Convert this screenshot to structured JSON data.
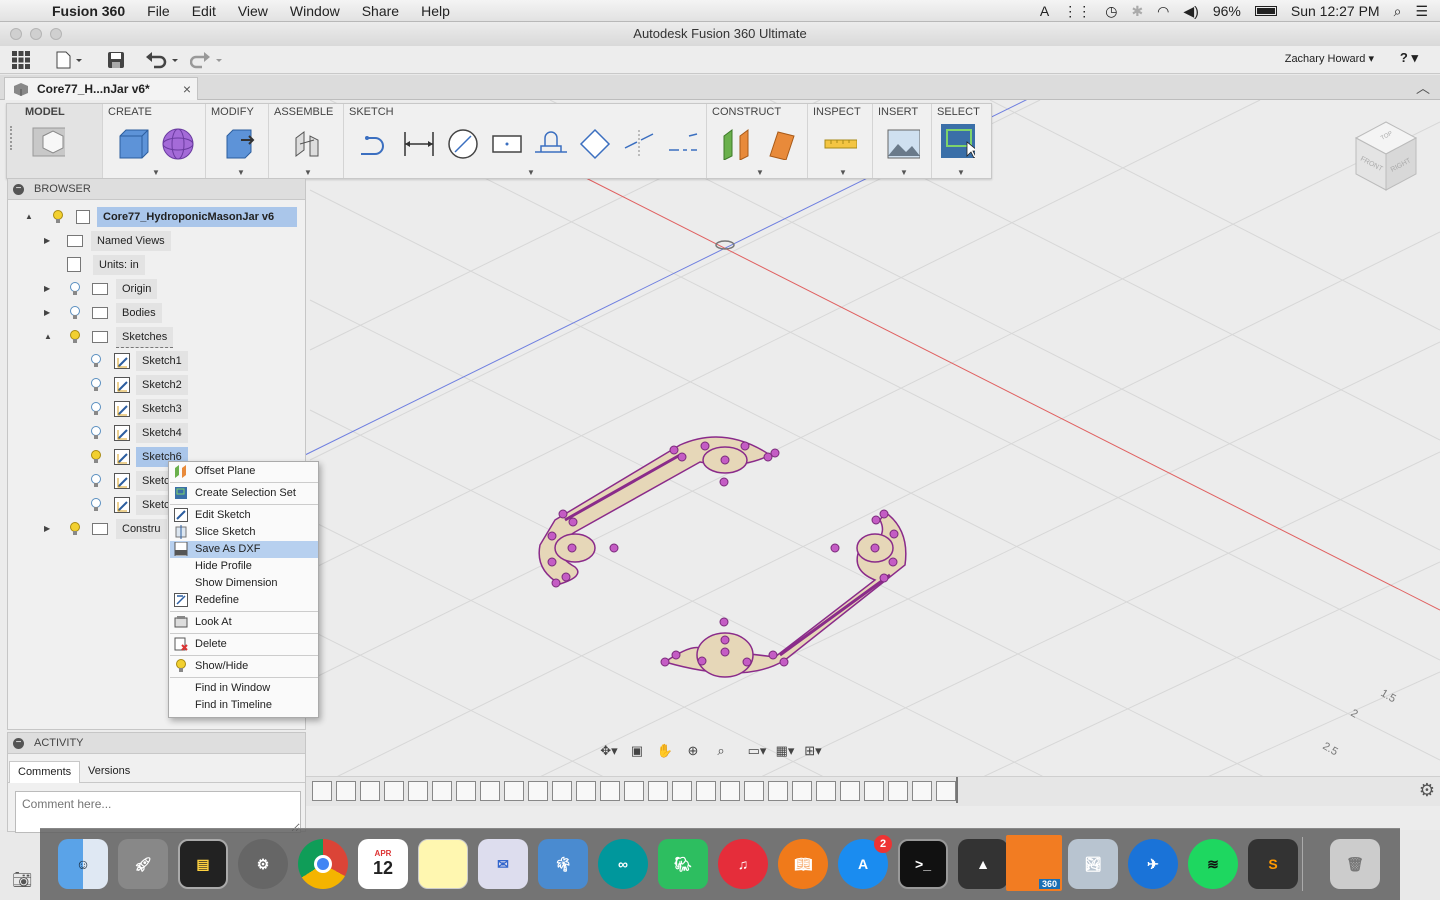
{
  "menubar": {
    "app_name": "Fusion 360",
    "items": [
      "File",
      "Edit",
      "View",
      "Window",
      "Share",
      "Help"
    ],
    "battery": "96%",
    "clock": "Sun 12:27 PM"
  },
  "window": {
    "title": "Autodesk Fusion 360 Ultimate"
  },
  "toolbar": {
    "user": "Zachary Howard ▾",
    "help": "? ▾"
  },
  "document_tab": {
    "title": "Core77_H...nJar v6*",
    "close": "×"
  },
  "ribbon": {
    "groups": [
      {
        "label": "MODEL"
      },
      {
        "label": "CREATE"
      },
      {
        "label": "MODIFY"
      },
      {
        "label": "ASSEMBLE"
      },
      {
        "label": "SKETCH"
      },
      {
        "label": "CONSTRUCT"
      },
      {
        "label": "INSPECT"
      },
      {
        "label": "INSERT"
      },
      {
        "label": "SELECT"
      }
    ]
  },
  "viewcube": {
    "top": "TOP",
    "front": "FRONT",
    "right": "RIGHT"
  },
  "browser": {
    "title": "BROWSER",
    "root": "Core77_HydroponicMasonJar v6",
    "nodes": {
      "named_views": "Named Views",
      "units": "Units: in",
      "origin": "Origin",
      "bodies": "Bodies",
      "sketches": "Sketches",
      "sketch1": "Sketch1",
      "sketch2": "Sketch2",
      "sketch3": "Sketch3",
      "sketch4": "Sketch4",
      "sketch6": "Sketch6",
      "sketch7": "Sketc",
      "sketch8": "Sketc",
      "construction": "Constru"
    }
  },
  "context_menu": {
    "items": [
      "Offset Plane",
      "Create Selection Set",
      "Edit Sketch",
      "Slice Sketch",
      "Save As DXF",
      "Hide Profile",
      "Show Dimension",
      "Redefine",
      "Look At",
      "Delete",
      "Show/Hide",
      "Find in Window",
      "Find in Timeline"
    ],
    "highlighted": "Save As DXF"
  },
  "activity": {
    "title": "ACTIVITY",
    "tabs": [
      "Comments",
      "Versions"
    ],
    "comment_placeholder": "Comment here..."
  },
  "grid_labels": [
    "1.5",
    "2",
    "2.5"
  ],
  "dock": {
    "calendar_month": "APR",
    "calendar_day": "12",
    "appstore_badge": "2",
    "fusion_label": "360"
  },
  "colors": {
    "sketch_fill": "#e6d7b8",
    "sketch_stroke": "#8a2b8a",
    "selection": "#aac6ea",
    "axis_red": "#e06060",
    "axis_blue": "#6f7fe0"
  }
}
